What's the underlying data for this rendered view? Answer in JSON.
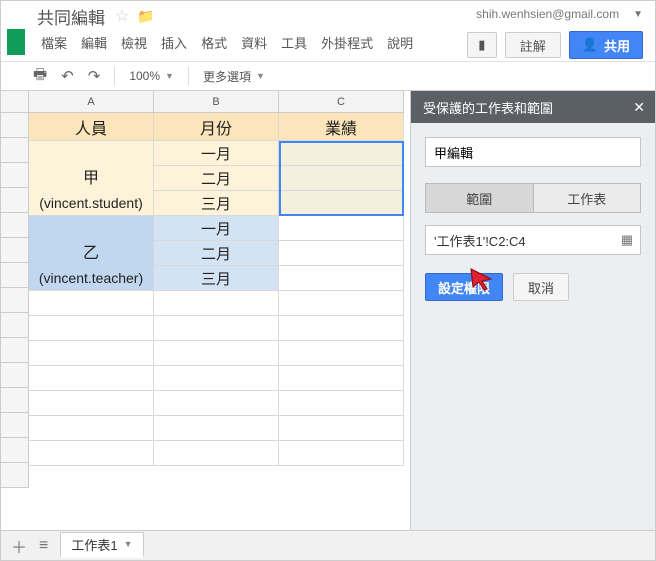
{
  "header": {
    "doc_title": "共同編輯",
    "account_email": "shih.wenhsien@gmail.com"
  },
  "menus": [
    "檔案",
    "編輯",
    "檢視",
    "插入",
    "格式",
    "資料",
    "工具",
    "外掛程式",
    "說明"
  ],
  "actions": {
    "comments_label": "註解",
    "share_label": "共用"
  },
  "toolbar": {
    "zoom": "100%",
    "more_options": "更多選項"
  },
  "columns": [
    "A",
    "B",
    "C"
  ],
  "sheet": {
    "header_row": {
      "a": "人員",
      "b": "月份",
      "c": "業績"
    },
    "groupA_name_line1": "甲",
    "groupA_name_line2": "(vincent.student)",
    "groupB_name_line1": "乙",
    "groupB_name_line2": "(vincent.teacher)",
    "months": [
      "一月",
      "二月",
      "三月"
    ]
  },
  "panel": {
    "title": "受保護的工作表和範圍",
    "name_value": "甲編輯",
    "tab_range": "範圍",
    "tab_sheet": "工作表",
    "range_value": "'工作表1'!C2:C4",
    "set_perm": "設定權限",
    "cancel": "取消"
  },
  "footer": {
    "tab_name": "工作表1"
  }
}
